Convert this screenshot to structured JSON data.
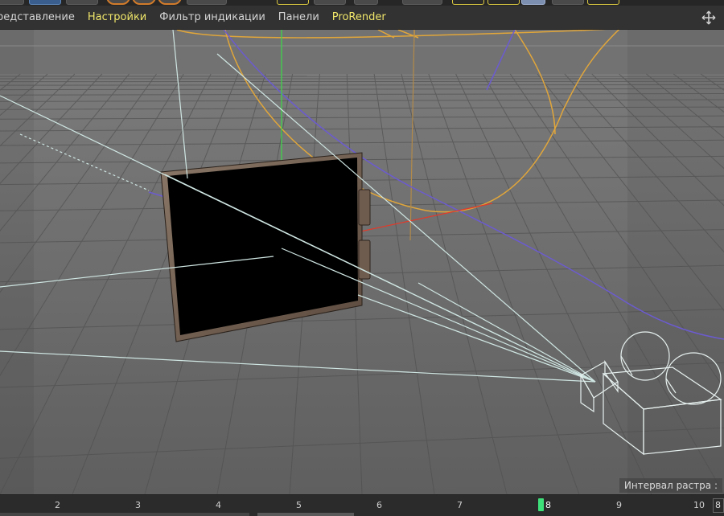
{
  "menu": {
    "items": [
      {
        "label": "редставление"
      },
      {
        "label": "Настройки"
      },
      {
        "label": "Фильтр индикации"
      },
      {
        "label": "Панели"
      },
      {
        "label": "ProRender"
      }
    ]
  },
  "viewport": {
    "raster_label": "Интервал растра :"
  },
  "timeline": {
    "ticks": [
      "2",
      "3",
      "4",
      "5",
      "6",
      "7",
      "8",
      "9",
      "10"
    ],
    "current_frame": "8",
    "frame_field": "8"
  },
  "colors": {
    "accent_menu": "#f0e66a",
    "playhead": "#3ee07a",
    "spline_orange": "#e1a63a",
    "spline_purple": "#6b5bd0",
    "camera_wire": "#cfe6e2"
  }
}
